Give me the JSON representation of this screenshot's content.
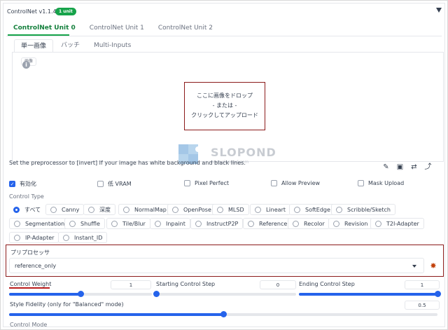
{
  "header": {
    "title": "ControlNet v1.1.440",
    "badge": "1 unit"
  },
  "tabs": [
    "ControlNet Unit 0",
    "ControlNet Unit 1",
    "ControlNet Unit 2"
  ],
  "subtabs": [
    "単一画像",
    "バッチ",
    "Multi-Inputs"
  ],
  "image_panel": {
    "label": "画像",
    "drop_line1": "ここに画像をドロップ",
    "drop_line2": "- または -",
    "drop_line3": "クリックしてアップロード"
  },
  "preprocessor_note": "Set the preprocessor to [invert] If your image has white background and black lines.",
  "checkboxes": [
    {
      "label": "有効化",
      "checked": true
    },
    {
      "label": "低 VRAM",
      "checked": false
    },
    {
      "label": "Pixel Perfect",
      "checked": false
    },
    {
      "label": "Allow Preview",
      "checked": false
    },
    {
      "label": "Mask Upload",
      "checked": false
    }
  ],
  "control_type": {
    "label": "Control Type",
    "selected": "すべて",
    "options": [
      "すべて",
      "Canny",
      "深度",
      "NormalMap",
      "OpenPose",
      "MLSD",
      "Lineart",
      "SoftEdge",
      "Scribble/Sketch",
      "Segmentation",
      "Shuffle",
      "Tile/Blur",
      "Inpaint",
      "InstructP2P",
      "Reference",
      "Recolor",
      "Revision",
      "T2I-Adapter",
      "IP-Adapter",
      "Instant_ID"
    ]
  },
  "preprocessor": {
    "label": "プリプロセッサ",
    "value": "reference_only"
  },
  "sliders": {
    "control_weight": {
      "label": "Control Weight",
      "value": "1",
      "fraction": 0.5
    },
    "starting_step": {
      "label": "Starting Control Step",
      "value": "0",
      "fraction": 0.0
    },
    "ending_step": {
      "label": "Ending Control Step",
      "value": "1",
      "fraction": 1.0
    },
    "style_fidelity": {
      "label": "Style Fidelity (only for \"Balanced\" mode)",
      "value": "0.5",
      "fraction": 0.5
    }
  },
  "control_mode_label": "Control Mode",
  "watermark": {
    "text": "SLOPOND",
    "sub": "www.slopond.com"
  },
  "colors": {
    "accent": "#2563eb",
    "tab_active": "#16a34a",
    "highlight_border": "#8b1a1a"
  }
}
